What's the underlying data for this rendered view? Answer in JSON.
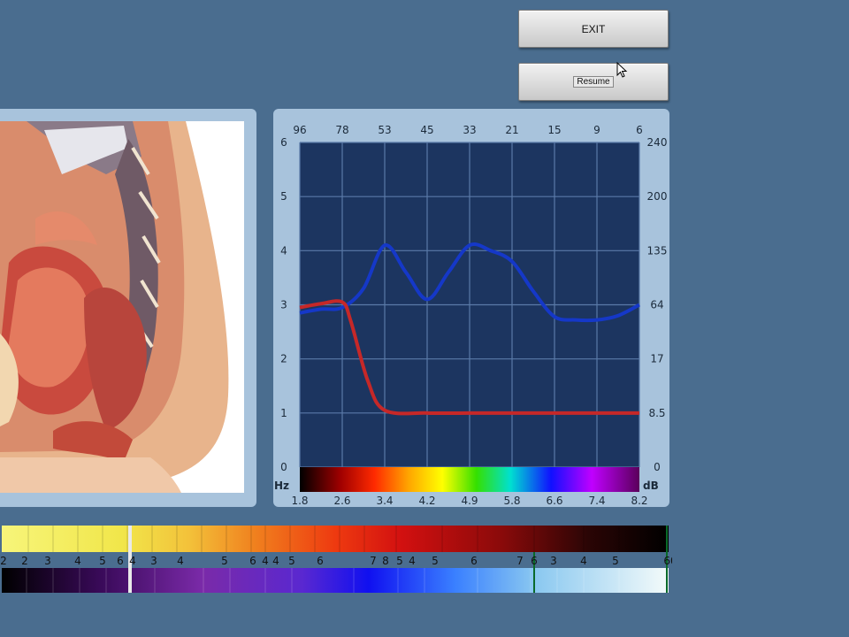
{
  "buttons": {
    "exit_label": "EXIT",
    "resume_label": "Resume"
  },
  "image_panel": {
    "icon": "pelvis-anatomy-illustration"
  },
  "chart_data": {
    "type": "line",
    "top_tick_labels": [
      "96",
      "78",
      "53",
      "45",
      "33",
      "21",
      "15",
      "9",
      "6"
    ],
    "bottom_tick_labels": [
      "1.8",
      "2.6",
      "3.4",
      "4.2",
      "4.9",
      "5.8",
      "6.6",
      "7.4",
      "8.2"
    ],
    "left_tick_labels": [
      "0",
      "1",
      "2",
      "3",
      "4",
      "5",
      "6"
    ],
    "right_tick_labels": [
      "0",
      "8.5",
      "17",
      "64",
      "135",
      "200",
      "240"
    ],
    "x_unit": "Hz",
    "right_unit": "dB",
    "ylim": [
      0,
      6
    ],
    "grid": true,
    "series": [
      {
        "color": "#1538c8",
        "x": [
          0,
          0.5,
          1,
          1.5,
          2,
          2.5,
          3,
          3.5,
          4,
          4.5,
          5,
          5.5,
          6,
          6.5,
          7,
          7.5,
          8
        ],
        "values": [
          2.85,
          2.92,
          2.95,
          3.3,
          4.1,
          3.6,
          3.1,
          3.6,
          4.1,
          4.0,
          3.8,
          3.25,
          2.78,
          2.72,
          2.72,
          2.8,
          3.0
        ]
      },
      {
        "color": "#c62828",
        "x": [
          0,
          0.5,
          1,
          1.2,
          1.6,
          2,
          3,
          4,
          5,
          6,
          7,
          8
        ],
        "values": [
          2.95,
          3.02,
          3.05,
          2.7,
          1.6,
          1.05,
          1.0,
          1.0,
          1.0,
          1.0,
          1.0,
          1.0
        ]
      }
    ],
    "colors": {
      "plot_bg": "#1c3560",
      "grid": "#5a7aa8"
    }
  },
  "strip": {
    "top_labels": [
      "2",
      "2",
      "3",
      "4",
      "5",
      "6",
      "4",
      "3",
      "4",
      "5",
      "6",
      "4",
      "4",
      "5",
      "6",
      "7",
      "8",
      "5",
      "4",
      "5",
      "6",
      "7",
      "6",
      "3",
      "4",
      "5",
      "60"
    ]
  }
}
